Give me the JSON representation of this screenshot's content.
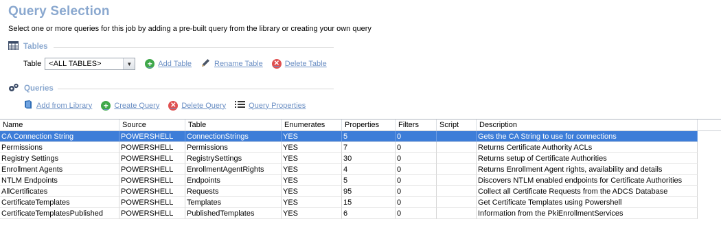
{
  "page": {
    "title": "Query Selection",
    "subtitle": "Select one or more queries for this job by adding a pre-built query from the library or creating your own query"
  },
  "tables_section": {
    "heading": "Tables",
    "table_label": "Table",
    "table_select_value": "<ALL TABLES>",
    "add_table": "Add Table",
    "rename_table": "Rename Table",
    "delete_table": "Delete Table"
  },
  "queries_section": {
    "heading": "Queries",
    "add_from_library": "Add from Library",
    "create_query": "Create Query",
    "delete_query": "Delete Query",
    "query_properties": "Query Properties"
  },
  "grid": {
    "columns": [
      "Name",
      "Source",
      "Table",
      "Enumerates",
      "Properties",
      "Filters",
      "Script",
      "Description"
    ],
    "rows": [
      [
        "CA Connection String",
        "POWERSHELL",
        "ConnectionStrings",
        "YES",
        "5",
        "0",
        "",
        "Gets the CA String to use for connections"
      ],
      [
        "Permissions",
        "POWERSHELL",
        "Permissions",
        "YES",
        "7",
        "0",
        "",
        "Returns Certificate Authority ACLs"
      ],
      [
        "Registry Settings",
        "POWERSHELL",
        "RegistrySettings",
        "YES",
        "30",
        "0",
        "",
        "Returns setup of Certificate Authorities"
      ],
      [
        "Enrollment Agents",
        "POWERSHELL",
        "EnrollmentAgentRights",
        "YES",
        "4",
        "0",
        "",
        "Returns Enrollment Agent rights, availability and details"
      ],
      [
        "NTLM Endpoints",
        "POWERSHELL",
        "Endpoints",
        "YES",
        "5",
        "0",
        "",
        "Discovers NTLM enabled endpoints for Certificate Authorities"
      ],
      [
        "AllCertificates",
        "POWERSHELL",
        "Requests",
        "YES",
        "95",
        "0",
        "",
        "Collect all Certificate Requests from the ADCS Database"
      ],
      [
        "CertificateTemplates",
        "POWERSHELL",
        "Templates",
        "YES",
        "15",
        "0",
        "",
        "Get Certificate Templates using Powershell"
      ],
      [
        "CertificateTemplatesPublished",
        "POWERSHELL",
        "PublishedTemplates",
        "YES",
        "6",
        "0",
        "",
        "Information from the PkiEnrollmentServices"
      ]
    ],
    "selected_row": 0
  },
  "colors": {
    "heading": "#8aa8cf",
    "link": "#6b8fc4",
    "selection": "#3d7dd8",
    "add_icon": "#3fa84a",
    "delete_icon": "#e05050"
  }
}
